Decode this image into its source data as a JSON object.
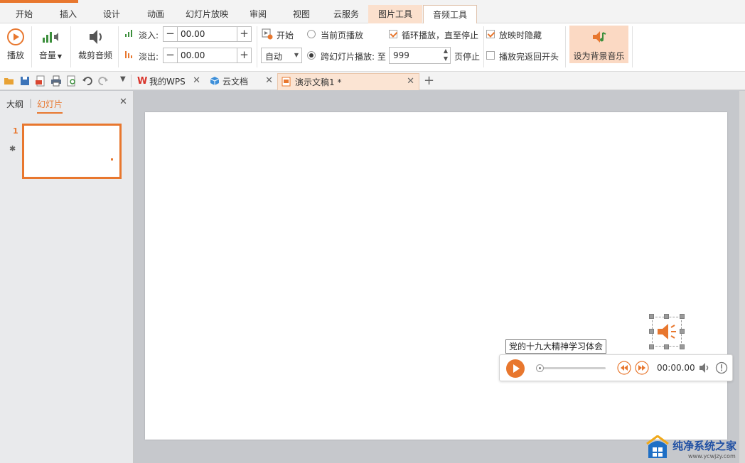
{
  "tabs": [
    {
      "label": "开始"
    },
    {
      "label": "插入"
    },
    {
      "label": "设计"
    },
    {
      "label": "动画"
    },
    {
      "label": "幻灯片放映"
    },
    {
      "label": "审阅"
    },
    {
      "label": "视图"
    },
    {
      "label": "云服务"
    },
    {
      "label": "图片工具"
    },
    {
      "label": "音频工具"
    }
  ],
  "ribbon": {
    "play_label": "播放",
    "volume_label": "音量",
    "trim_label": "裁剪音频",
    "fade_in_label": "淡入:",
    "fade_in_value": "00.00",
    "fade_out_label": "淡出:",
    "fade_out_value": "00.00",
    "start_label": "开始",
    "start_mode_value": "自动",
    "current_page_label": "当前页播放",
    "cross_slides_label": "跨幻灯片播放: 至",
    "cross_slides_value": "999",
    "page_stop_label": "页停止",
    "loop_label": "循环播放，直至停止",
    "hide_label": "放映时隐藏",
    "rewind_label": "播放完返回开头",
    "set_bg_music_label": "设为背景音乐"
  },
  "doc_tabs": [
    {
      "label": "我的WPS"
    },
    {
      "label": "云文档"
    },
    {
      "label": "演示文稿1 *"
    }
  ],
  "pane": {
    "outline_label": "大纲",
    "slides_label": "幻灯片",
    "slide_number": "1"
  },
  "audio": {
    "tooltip": "党的十九大精神学习体会",
    "time": "00:00.00"
  },
  "brand": {
    "name": "纯净系统之家",
    "url": "www.ycwjzy.com"
  },
  "colors": {
    "accent": "#e8772e",
    "tool_tab_bg": "#fbe0cd"
  }
}
